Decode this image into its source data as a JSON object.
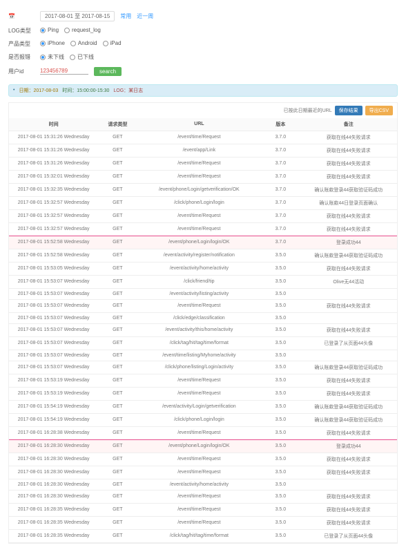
{
  "filters": {
    "date_icon": "2017-08-01 至 2017-08-15",
    "date_actions": [
      "常用",
      "近一周"
    ],
    "log_label": "LOG类型",
    "log_options": [
      {
        "label": "Ping",
        "checked": true
      },
      {
        "label": "request_log",
        "checked": false
      }
    ],
    "product_label": "产品类型",
    "product_options": [
      {
        "label": "iPhone",
        "checked": true
      },
      {
        "label": "Android",
        "checked": false
      },
      {
        "label": "iPad",
        "checked": false
      }
    ],
    "error_label": "是否报错",
    "error_options": [
      {
        "label": "未下线",
        "checked": true
      },
      {
        "label": "已下线",
        "checked": false
      }
    ],
    "user_label": "用户id",
    "user_value": "123456789",
    "search_btn": "search"
  },
  "info_bar": {
    "seg1": "日期：2017-08-03",
    "seg2": "时间：15:00:00-15:30",
    "seg3": "LOG：某日志"
  },
  "table_top": {
    "note": "已按此日期最近的URL",
    "btn1": "保存结果",
    "btn2": "导出CSV"
  },
  "columns": [
    "时间",
    "请求类型",
    "URL",
    "版本",
    "备注"
  ],
  "rows": [
    {
      "t": "2017-08-01 15:31:26 Wednesday",
      "m": "GET",
      "u": "/event/time/Request",
      "v": "3.7.0",
      "r": "获取在线44失败请求"
    },
    {
      "t": "2017-08-01 15:31:26 Wednesday",
      "m": "GET",
      "u": "/event/app/Link",
      "v": "3.7.0",
      "r": "获取在线44失败请求"
    },
    {
      "t": "2017-08-01 15:31:26 Wednesday",
      "m": "GET",
      "u": "/event/time/Request",
      "v": "3.7.0",
      "r": "获取在线44失败请求"
    },
    {
      "t": "2017-08-01 15:32:01 Wednesday",
      "m": "GET",
      "u": "/event/time/Request",
      "v": "3.7.0",
      "r": "获取在线44失败请求"
    },
    {
      "t": "2017-08-01 15:32:35 Wednesday",
      "m": "GET",
      "u": "/event/phone/Login/getverification/OK",
      "v": "3.7.0",
      "r": "确认账款登录44获取验证码成功"
    },
    {
      "t": "2017-08-01 15:32:57 Wednesday",
      "m": "GET",
      "u": "/click/phone/Login/login",
      "v": "3.7.0",
      "r": "确认账款44日登录页面确认"
    },
    {
      "t": "2017-08-01 15:32:57 Wednesday",
      "m": "GET",
      "u": "/event/time/Request",
      "v": "3.7.0",
      "r": "获取在线44失败请求"
    },
    {
      "t": "2017-08-01 15:32:57 Wednesday",
      "m": "GET",
      "u": "/event/time/Request",
      "v": "3.7.0",
      "r": "获取在线44失败请求"
    },
    {
      "t": "2017-08-01 15:52:58 Wednesday",
      "m": "GET",
      "u": "/event/phone/Login/login/OK",
      "v": "3.7.0",
      "r": "登录成功44",
      "hl": true
    },
    {
      "t": "2017-08-01 15:52:58 Wednesday",
      "m": "GET",
      "u": "/event/activity/register/notification",
      "v": "3.5.0",
      "r": "确认账款登录44获取验证码成功"
    },
    {
      "t": "2017-08-01 15:53:05 Wednesday",
      "m": "GET",
      "u": "/event/activity/home/activity",
      "v": "3.5.0",
      "r": "获取在线44失败请求"
    },
    {
      "t": "2017-08-01 15:53:07 Wednesday",
      "m": "GET",
      "u": "/click/friend/tip",
      "v": "3.5.0",
      "r": "Olive无44活动"
    },
    {
      "t": "2017-08-01 15:53:07 Wednesday",
      "m": "GET",
      "u": "/event/activity/listing/activity",
      "v": "3.5.0",
      "r": ""
    },
    {
      "t": "2017-08-01 15:53:07 Wednesday",
      "m": "GET",
      "u": "/event/time/Request",
      "v": "3.5.0",
      "r": "获取在线44失败请求"
    },
    {
      "t": "2017-08-01 15:53:07 Wednesday",
      "m": "GET",
      "u": "/click/edge/classification",
      "v": "3.5.0",
      "r": ""
    },
    {
      "t": "2017-08-01 15:53:07 Wednesday",
      "m": "GET",
      "u": "/event/activity/this/home/activity",
      "v": "3.5.0",
      "r": "获取在线44失败请求"
    },
    {
      "t": "2017-08-01 15:53:07 Wednesday",
      "m": "GET",
      "u": "/click/tag/hit/tag/time/format",
      "v": "3.5.0",
      "r": "已登录了从页面44头像"
    },
    {
      "t": "2017-08-01 15:53:07 Wednesday",
      "m": "GET",
      "u": "/event/time/listing/Myhome/activity",
      "v": "3.5.0",
      "r": ""
    },
    {
      "t": "2017-08-01 15:53:07 Wednesday",
      "m": "GET",
      "u": "/click/phone/listing/Login/activity",
      "v": "3.5.0",
      "r": "确认账款登录44获取验证码成功"
    },
    {
      "t": "2017-08-01 15:53:19 Wednesday",
      "m": "GET",
      "u": "/event/time/Request",
      "v": "3.5.0",
      "r": "获取在线44失败请求"
    },
    {
      "t": "2017-08-01 15:53:19 Wednesday",
      "m": "GET",
      "u": "/event/time/Request",
      "v": "3.5.0",
      "r": "获取在线44失败请求"
    },
    {
      "t": "2017-08-01 15:54:19 Wednesday",
      "m": "GET",
      "u": "/event/activity/Login/getverification",
      "v": "3.5.0",
      "r": "确认账款登录44获取验证码成功"
    },
    {
      "t": "2017-08-01 15:54:19 Wednesday",
      "m": "GET",
      "u": "/click/phone/Login/login",
      "v": "3.5.0",
      "r": "确认账款登录44获取验证码成功"
    },
    {
      "t": "2017-08-01 16:28:38 Wednesday",
      "m": "GET",
      "u": "/event/time/Request",
      "v": "3.5.0",
      "r": "获取在线44失败请求"
    },
    {
      "t": "2017-08-01 16:28:30 Wednesday",
      "m": "GET",
      "u": "/event/phone/Login/login/OK",
      "v": "3.5.0",
      "r": "登录成功44",
      "hl": true
    },
    {
      "t": "2017-08-01 16:28:30 Wednesday",
      "m": "GET",
      "u": "/event/time/Request",
      "v": "3.5.0",
      "r": "获取在线44失败请求"
    },
    {
      "t": "2017-08-01 16:28:30 Wednesday",
      "m": "GET",
      "u": "/event/time/Request",
      "v": "3.5.0",
      "r": "获取在线44失败请求"
    },
    {
      "t": "2017-08-01 16:28:30 Wednesday",
      "m": "GET",
      "u": "/event/activity/home/activity",
      "v": "3.5.0",
      "r": ""
    },
    {
      "t": "2017-08-01 16:28:30 Wednesday",
      "m": "GET",
      "u": "/event/time/Request",
      "v": "3.5.0",
      "r": "获取在线44失败请求"
    },
    {
      "t": "2017-08-01 16:28:35 Wednesday",
      "m": "GET",
      "u": "/event/time/Request",
      "v": "3.5.0",
      "r": "获取在线44失败请求"
    },
    {
      "t": "2017-08-01 16:28:35 Wednesday",
      "m": "GET",
      "u": "/event/time/Request",
      "v": "3.5.0",
      "r": "获取在线44失败请求"
    },
    {
      "t": "2017-08-01 16:28:35 Wednesday",
      "m": "GET",
      "u": "/click/tag/hit/tag/time/format",
      "v": "3.5.0",
      "r": "已登录了从页面44头像"
    }
  ]
}
